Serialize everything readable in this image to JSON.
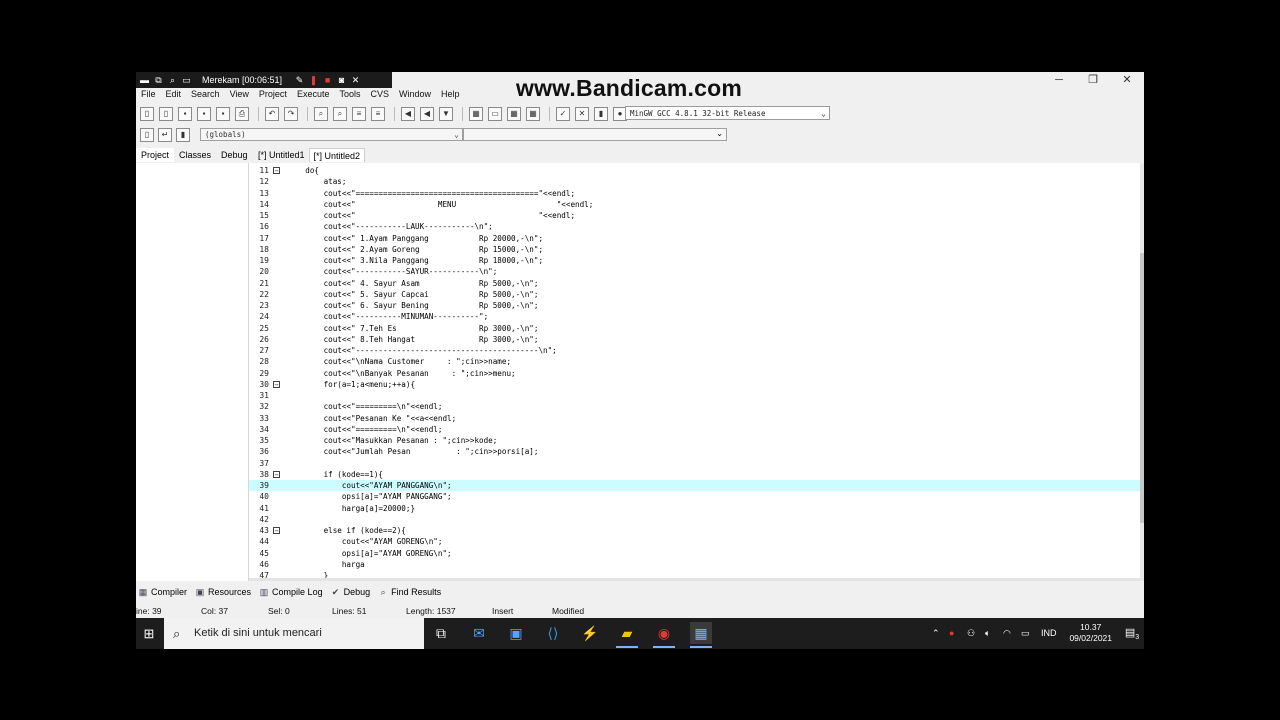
{
  "recorder": {
    "title": "Merekam [00:06:51]",
    "watermark": "www.Bandicam.com"
  },
  "window_controls": {
    "minimize": "─",
    "maximize": "❐",
    "close": "✕"
  },
  "menubar": [
    "File",
    "Edit",
    "Search",
    "View",
    "Project",
    "Execute",
    "Tools",
    "CVS",
    "Window",
    "Help"
  ],
  "toolbar": {
    "compiler": "MinGW GCC 4.8.1 32-bit Release",
    "globals": "(globals)"
  },
  "panel_tabs": [
    "Project",
    "Classes",
    "Debug"
  ],
  "editor_tabs": [
    {
      "label": "[*] Untitled1",
      "active": false
    },
    {
      "label": "[*] Untitled2",
      "active": true
    }
  ],
  "code_lines": [
    {
      "n": "11",
      "fold": "⊟",
      "text": "    do{"
    },
    {
      "n": "12",
      "fold": "",
      "text": "        atas;"
    },
    {
      "n": "13",
      "fold": "",
      "text": "        cout<<\"========================================\"<<endl;"
    },
    {
      "n": "14",
      "fold": "",
      "text": "        cout<<\"                  MENU                      \"<<endl;"
    },
    {
      "n": "15",
      "fold": "",
      "text": "        cout<<\"                                        \"<<endl;"
    },
    {
      "n": "16",
      "fold": "",
      "text": "        cout<<\"-----------LAUK-----------\\n\";"
    },
    {
      "n": "17",
      "fold": "",
      "text": "        cout<<\" 1.Ayam Panggang           Rp 20000,-\\n\";"
    },
    {
      "n": "18",
      "fold": "",
      "text": "        cout<<\" 2.Ayam Goreng             Rp 15000,-\\n\";"
    },
    {
      "n": "19",
      "fold": "",
      "text": "        cout<<\" 3.Nila Panggang           Rp 18000,-\\n\";"
    },
    {
      "n": "20",
      "fold": "",
      "text": "        cout<<\"-----------SAYUR-----------\\n\";"
    },
    {
      "n": "21",
      "fold": "",
      "text": "        cout<<\" 4. Sayur Asam             Rp 5000,-\\n\";"
    },
    {
      "n": "22",
      "fold": "",
      "text": "        cout<<\" 5. Sayur Capcai           Rp 5000,-\\n\";"
    },
    {
      "n": "23",
      "fold": "",
      "text": "        cout<<\" 6. Sayur Bening           Rp 5000,-\\n\";"
    },
    {
      "n": "24",
      "fold": "",
      "text": "        cout<<\"----------MINUMAN----------\";"
    },
    {
      "n": "25",
      "fold": "",
      "text": "        cout<<\" 7.Teh Es                  Rp 3000,-\\n\";"
    },
    {
      "n": "26",
      "fold": "",
      "text": "        cout<<\" 8.Teh Hangat              Rp 3000,-\\n\";"
    },
    {
      "n": "27",
      "fold": "",
      "text": "        cout<<\"----------------------------------------\\n\";"
    },
    {
      "n": "28",
      "fold": "",
      "text": "        cout<<\"\\nNama Customer     : \";cin>>name;"
    },
    {
      "n": "29",
      "fold": "",
      "text": "        cout<<\"\\nBanyak Pesanan     : \";cin>>menu;"
    },
    {
      "n": "30",
      "fold": "⊟",
      "text": "        for(a=1;a<menu;++a){"
    },
    {
      "n": "31",
      "fold": "",
      "text": ""
    },
    {
      "n": "32",
      "fold": "",
      "text": "        cout<<\"=========\\n\"<<endl;"
    },
    {
      "n": "33",
      "fold": "",
      "text": "        cout<<\"Pesanan Ke \"<<a<<endl;"
    },
    {
      "n": "34",
      "fold": "",
      "text": "        cout<<\"=========\\n\"<<endl;"
    },
    {
      "n": "35",
      "fold": "",
      "text": "        cout<<\"Masukkan Pesanan : \";cin>>kode;"
    },
    {
      "n": "36",
      "fold": "",
      "text": "        cout<<\"Jumlah Pesan          : \";cin>>porsi[a];"
    },
    {
      "n": "37",
      "fold": "",
      "text": ""
    },
    {
      "n": "38",
      "fold": "⊟",
      "text": "        if (kode==1){"
    },
    {
      "n": "39",
      "fold": "",
      "text": "            cout<<\"AYAM PANGGANG\\n\";"
    },
    {
      "n": "40",
      "fold": "",
      "text": "            opsi[a]=\"AYAM PANGGANG\";"
    },
    {
      "n": "41",
      "fold": "",
      "text": "            harga[a]=20000;}"
    },
    {
      "n": "42",
      "fold": "",
      "text": ""
    },
    {
      "n": "43",
      "fold": "⊟",
      "text": "        else if (kode==2){"
    },
    {
      "n": "44",
      "fold": "",
      "text": "            cout<<\"AYAM GORENG\\n\";"
    },
    {
      "n": "45",
      "fold": "",
      "text": "            opsi[a]=\"AYAM GORENG\\n\";"
    },
    {
      "n": "46",
      "fold": "",
      "text": "            harga"
    },
    {
      "n": "47",
      "fold": "",
      "text": "        }"
    }
  ],
  "highlighted_line": "39",
  "bottom_tabs": [
    {
      "icon": "compiler-icon",
      "glyph": "▦",
      "label": "Compiler"
    },
    {
      "icon": "resources-icon",
      "glyph": "▣",
      "label": "Resources"
    },
    {
      "icon": "compile-log-icon",
      "glyph": "▥",
      "label": "Compile Log"
    },
    {
      "icon": "debug-icon",
      "glyph": "✔",
      "label": "Debug"
    },
    {
      "icon": "find-results-icon",
      "glyph": "⌕",
      "label": "Find Results"
    }
  ],
  "status": {
    "line": "ine:  39",
    "col": "Col:  37",
    "sel": "Sel:  0",
    "lines": "Lines:  51",
    "length": "Length:  1537",
    "insert": "Insert",
    "modified": "Modified"
  },
  "taskbar": {
    "search_placeholder": "Ketik di sini untuk mencari",
    "language": "IND",
    "time": "10.37",
    "date": "09/02/2021",
    "notification_count": "3"
  }
}
